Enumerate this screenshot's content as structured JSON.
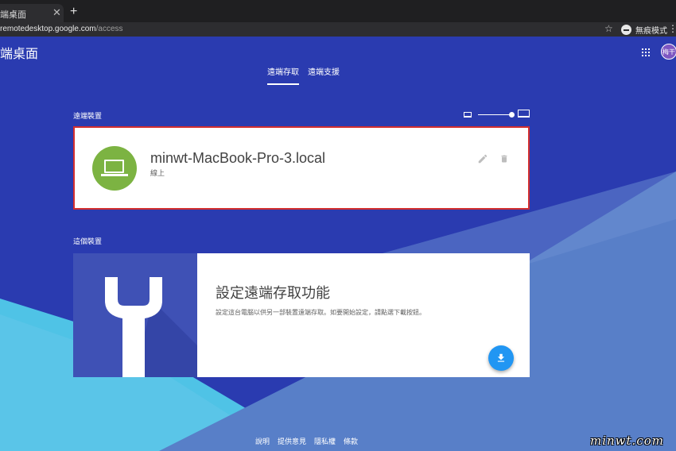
{
  "browser": {
    "tab_title": "端桌面",
    "tab_close": "✕",
    "new_tab": "+",
    "url_host": "remotedesktop.google.com",
    "url_path": "/access",
    "bookmark_star": "☆",
    "incognito_label": "無痕模式",
    "menu": "⋮"
  },
  "app": {
    "title": "端桌面",
    "avatar_text": "梅干"
  },
  "nav": {
    "tabs": [
      {
        "label": "遠端存取",
        "active": true
      },
      {
        "label": "遠端支援",
        "active": false
      }
    ]
  },
  "remote_devices": {
    "section_label": "遠端裝置",
    "device": {
      "name": "minwt-MacBook-Pro-3.local",
      "status": "線上"
    }
  },
  "this_device": {
    "section_label": "這個裝置",
    "title": "設定遠端存取功能",
    "description": "設定這台電腦以供另一部裝置遠端存取。如要開始設定，請點選下載按鈕。"
  },
  "footer": {
    "links": [
      "說明",
      "提供意見",
      "隱私權",
      "條款"
    ]
  },
  "watermark": "minwt.com",
  "colors": {
    "background": "#2a3bb0",
    "device_icon": "#7cb342",
    "highlight_border": "#d32f2f",
    "fab": "#2196f3"
  }
}
